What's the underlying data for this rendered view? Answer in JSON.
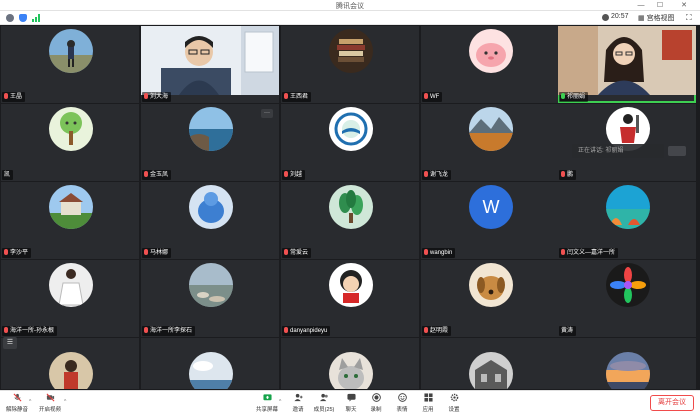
{
  "window": {
    "title": "腾讯会议"
  },
  "infobar": {
    "time": "20:57",
    "view_label": "宫格视图"
  },
  "participants": [
    {
      "name": "王晶",
      "avatar": "photo-person-outdoor",
      "mic": "muted"
    },
    {
      "name": "刘大海",
      "avatar": "video-man-glasses",
      "mic": "muted"
    },
    {
      "name": "王西君",
      "avatar": "photo-books-dessert",
      "mic": "muted"
    },
    {
      "name": "WF",
      "avatar": "cartoon-pink-character",
      "mic": "muted"
    },
    {
      "name": "祁丽娟",
      "avatar": "video-woman-glasses",
      "mic": "on",
      "active": true
    },
    {
      "name": "凯",
      "avatar": "drawing-green-tree",
      "mic": "none"
    },
    {
      "name": "金玉凤",
      "avatar": "photo-sea-rocks",
      "mic": "muted"
    },
    {
      "name": "刘越",
      "avatar": "logo-costa-emblem",
      "mic": "muted"
    },
    {
      "name": "谢飞龙",
      "avatar": "photo-mountain-lake",
      "mic": "muted"
    },
    {
      "name": "鹏",
      "avatar": "drawing-fighter",
      "mic": "muted"
    },
    {
      "name": "李沙平",
      "avatar": "photo-house-garden",
      "mic": "muted"
    },
    {
      "name": "马林娜",
      "avatar": "photo-blue-figurine",
      "mic": "muted"
    },
    {
      "name": "常爱云",
      "avatar": "photo-green-plant",
      "mic": "muted"
    },
    {
      "name": "wangbin",
      "avatar": "letter",
      "letter": "W",
      "mic": "muted"
    },
    {
      "name": "闫文义—嘉洋一所",
      "avatar": "photo-coral-reef",
      "mic": "muted"
    },
    {
      "name": "海洋一所-孙永根",
      "avatar": "photo-girl-white-dress",
      "mic": "muted"
    },
    {
      "name": "海洋一所李探石",
      "avatar": "photo-beach-stones",
      "mic": "muted"
    },
    {
      "name": "danyanpideyu",
      "avatar": "cartoon-girl-red",
      "mic": "muted"
    },
    {
      "name": "赵明霞",
      "avatar": "photo-puppy",
      "mic": "muted"
    },
    {
      "name": "黄涛",
      "avatar": "photo-colorful-flower",
      "mic": "none"
    },
    {
      "name": "",
      "avatar": "photo-girl-lantern",
      "mic": "none"
    },
    {
      "name": "",
      "avatar": "photo-cloudy-lake",
      "mic": "none"
    },
    {
      "name": "",
      "avatar": "photo-cat-kitten",
      "mic": "none"
    },
    {
      "name": "",
      "avatar": "photo-building-bw",
      "mic": "none"
    },
    {
      "name": "",
      "avatar": "photo-sunset-clouds",
      "mic": "none"
    }
  ],
  "speaking": {
    "prefix": "正在讲话:",
    "name": "祁丽娟"
  },
  "toolbar": {
    "unmute": "解除静音",
    "start_video": "开启视频",
    "share": "共享屏幕",
    "invite": "邀请",
    "members": "成员(25)",
    "chat": "聊天",
    "record": "录制",
    "reactions": "表情",
    "apps": "应用",
    "settings": "设置",
    "leave": "离开会议"
  },
  "colors": {
    "active_border": "#3ecf52",
    "leave": "#e43b3b",
    "avatar_w": "#2d6fdb"
  }
}
